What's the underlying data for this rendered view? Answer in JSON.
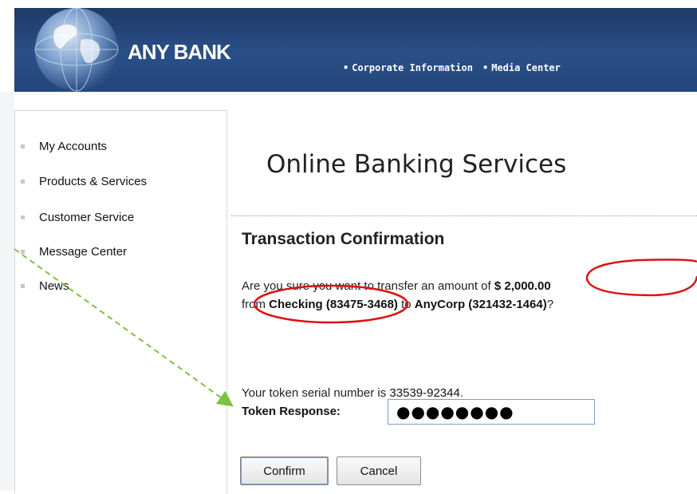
{
  "header": {
    "brand": "ANY BANK",
    "nav": [
      {
        "label": "Corporate Information"
      },
      {
        "label": "Media Center"
      }
    ]
  },
  "sidebar": {
    "items": [
      {
        "label": "My Accounts"
      },
      {
        "label": "Products & Services"
      },
      {
        "label": "Customer Service"
      },
      {
        "label": "Message Center"
      },
      {
        "label": "News"
      }
    ]
  },
  "main": {
    "title": "Online Banking Services",
    "section_title": "Transaction Confirmation",
    "question": {
      "part1": "Are you sure you want to transfer an amount of ",
      "amount": "$ 2,000.00",
      "part2": "from ",
      "from_account": "Checking (83475-3468)",
      "part3": " to ",
      "to_account": "AnyCorp (321432-1464)",
      "part4": "?"
    },
    "serial_prefix": "Your token serial number is ",
    "serial_number": "33539-92344",
    "serial_suffix": ".",
    "token_label": "Token Response:",
    "token_value": "●●●●●●●●",
    "confirm_label": "Confirm",
    "cancel_label": "Cancel"
  },
  "colors": {
    "header_bg": "#23457a",
    "highlight_red": "#dd1111",
    "arrow_green": "#7dc242"
  }
}
